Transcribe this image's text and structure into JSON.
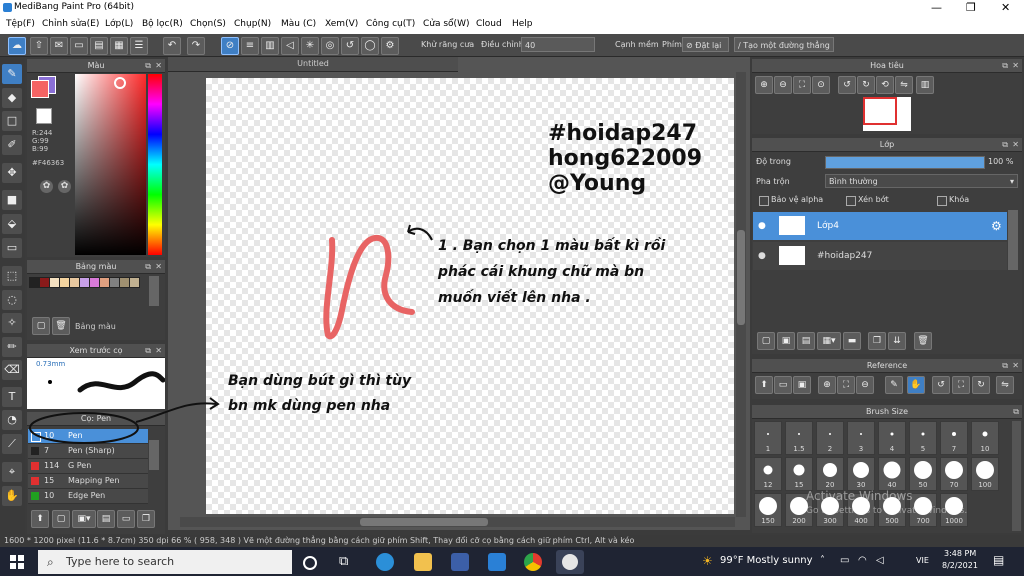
{
  "window": {
    "title": "MediBang Paint Pro (64bit)",
    "minimize": "—",
    "maximize": "❐",
    "close": "✕"
  },
  "menu": [
    "Tệp(F)",
    "Chỉnh sửa(E)",
    "Lớp(L)",
    "Bộ lọc(R)",
    "Chọn(S)",
    "Chụp(N)",
    "Màu (C)",
    "Xem(V)",
    "Công cụ(T)",
    "Cửa sổ(W)",
    "Cloud",
    "Help"
  ],
  "toolbar": {
    "antialias_label": "Khử răng cưa",
    "correction_label": "Điều chỉnh",
    "correction_value": "40",
    "snap_label": "Cạnh mềm",
    "keys_label": "Phím",
    "reset_label": "Đặt lại",
    "new_ruler_label": "Tạo một đường thẳng"
  },
  "color_panel": {
    "title": "Màu",
    "r": "R:244",
    "g": "G:99",
    "b": "B:99",
    "hex": "#F46363",
    "main_color": "#F46363",
    "sub_color": "#8a6fd6"
  },
  "palette_panel": {
    "title": "Bảng màu",
    "footer_label": "Bảng màu",
    "swatches": [
      "#222222",
      "#8a1a1a",
      "#f4e0c0",
      "#f4d4a0",
      "#e8c8a0",
      "#c8a0e8",
      "#d87ad8",
      "#e0a080",
      "#808080",
      "#a09070",
      "#c0b090"
    ]
  },
  "preview_panel": {
    "title": "Xem trước cọ",
    "size": "0.73mm"
  },
  "brush_panel": {
    "title": "Cọ: Pen",
    "brushes": [
      {
        "size": "10",
        "name": "Pen",
        "color": "#4a90d9"
      },
      {
        "size": "7",
        "name": "Pen (Sharp)",
        "color": "#222222"
      },
      {
        "size": "114",
        "name": "G Pen",
        "color": "#e03030"
      },
      {
        "size": "15",
        "name": "Mapping Pen",
        "color": "#e03030"
      },
      {
        "size": "10",
        "name": "Edge Pen",
        "color": "#20a020"
      }
    ]
  },
  "document": {
    "tab_title": "Untitled"
  },
  "canvas": {
    "tag_lines": [
      "#hoidap247",
      "hong622009",
      "@Young"
    ],
    "note_right": [
      "1 . Bạn chọn 1 màu bất kì rồi",
      "phác cái khung chữ mà bn",
      "muốn viết lên nha ."
    ],
    "note_left": [
      "Bạn dùng bút gì thì tùy",
      "bn mk dùng pen nha"
    ]
  },
  "navigator_panel": {
    "title": "Hoa tiêu"
  },
  "layer_panel": {
    "title": "Lớp",
    "opacity_label": "Độ trong",
    "opacity_value": "100 %",
    "opacity_fraction": 1.0,
    "blend_label": "Pha trộn",
    "blend_value": "Bình thường",
    "protect_alpha": "Bảo vệ alpha",
    "clipping": "Xén bớt",
    "lock": "Khóa",
    "layers": [
      {
        "name": "Lớp4",
        "selected": true
      },
      {
        "name": "#hoidap247",
        "selected": false
      }
    ]
  },
  "reference_panel": {
    "title": "Reference"
  },
  "brush_size_panel": {
    "title": "Brush Size",
    "sizes": [
      "1",
      "1.5",
      "2",
      "3",
      "4",
      "5",
      "7",
      "10",
      "12",
      "15",
      "20",
      "30",
      "40",
      "50",
      "70",
      "100",
      "150",
      "200",
      "300",
      "400",
      "500",
      "700",
      "1000"
    ]
  },
  "watermark": {
    "line1": "Activate Windows",
    "line2": "Go to Settings to activate Windows."
  },
  "status": {
    "text": "1600 * 1200 pixel  (11.6 * 8.7cm)  350 dpi  66 %  ( 958, 348 )  Vẽ một đường thẳng bằng cách giữ phím Shift, Thay đổi cỡ cọ bằng cách giữ phím Ctrl, Alt và kéo"
  },
  "taskbar": {
    "search_placeholder": "Type here to search",
    "weather": "99°F  Mostly sunny",
    "lang": "VIE",
    "time": "3:48 PM",
    "date": "8/2/2021"
  }
}
